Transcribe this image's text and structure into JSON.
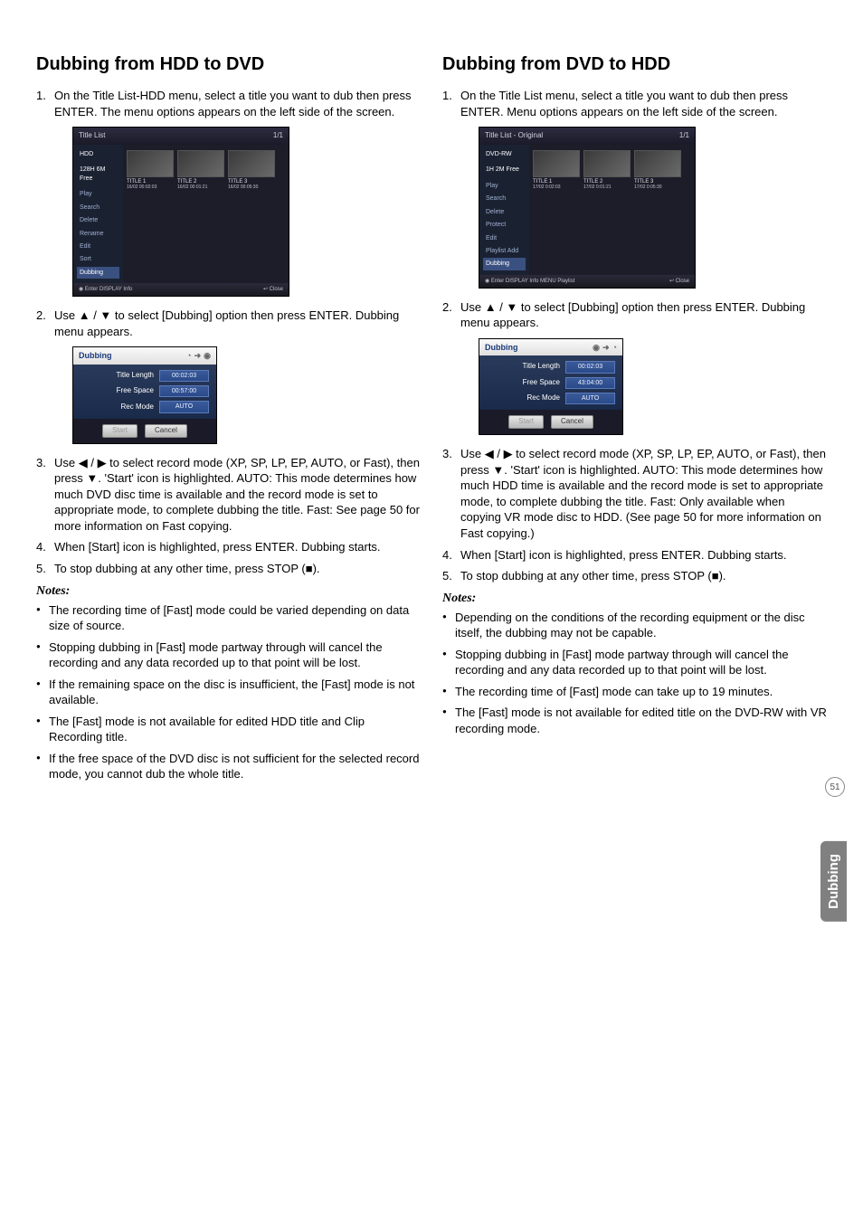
{
  "section_tab": "Dubbing",
  "page_number": "51",
  "left": {
    "heading": "Dubbing from HDD to DVD",
    "steps": [
      "On the Title List-HDD menu, select a title you want to dub then press ENTER.\nThe menu options appears on the left side of the screen.",
      "Use ▲ / ▼ to select [Dubbing] option then press ENTER.\nDubbing menu appears.",
      "Use ◀ / ▶ to select record mode (XP, SP, LP, EP, AUTO, or Fast), then press ▼.\n'Start' icon is highlighted.\nAUTO: This mode determines how much DVD disc time is available and the record mode is set to appropriate mode, to complete dubbing the title.\nFast: See page 50 for more information on Fast copying.",
      "When [Start] icon is highlighted, press ENTER. Dubbing starts.",
      "To stop dubbing at any other time, press STOP (■)."
    ],
    "notes_label": "Notes:",
    "notes": [
      "The recording time of [Fast] mode could be varied depending on data size of source.",
      "Stopping dubbing in [Fast] mode partway through will cancel the recording and any data recorded up to that point will be lost.",
      "If the remaining space on the disc is insufficient, the [Fast] mode is not available.",
      "The [Fast] mode is not available for edited HDD title and Clip Recording title.",
      "If the free space of the DVD disc is not sufficient for the selected record mode, you cannot dub the whole title."
    ],
    "title_list": {
      "title": "Title List",
      "page": "1/1",
      "source": "HDD",
      "capacity": "128H 6M Free",
      "menu": [
        "Play",
        "Search",
        "Delete",
        "Rename",
        "Edit",
        "Sort",
        "Dubbing"
      ],
      "thumbs": [
        {
          "t": "TITLE 1",
          "d": "16/02  00:02:03"
        },
        {
          "t": "TITLE 2",
          "d": "16/02  00:01:21"
        },
        {
          "t": "TITLE 3",
          "d": "16/02  00:05:30"
        }
      ],
      "footer_left": "◉ Enter  DISPLAY Info",
      "footer_right": "↩ Close"
    },
    "dub_panel": {
      "header": "Dubbing",
      "arrow_icons": "HDD ➜ DVD",
      "rows": [
        {
          "label": "Title Length",
          "value": "00:02:03"
        },
        {
          "label": "Free Space",
          "value": "00:57:00"
        },
        {
          "label": "Rec Mode",
          "value": "AUTO"
        }
      ],
      "start": "Start",
      "cancel": "Cancel"
    }
  },
  "right": {
    "heading": "Dubbing from DVD to HDD",
    "steps": [
      "On the Title List menu, select a title you want to dub then press ENTER.\nMenu options appears on the left side of the screen.",
      "Use ▲ / ▼ to select [Dubbing] option then press ENTER.\nDubbing menu appears.",
      "Use ◀ / ▶ to select record mode (XP, SP, LP, EP, AUTO, or Fast), then press ▼.\n'Start' icon is highlighted.\nAUTO: This mode determines how much HDD time is available and the record mode is set to appropriate mode, to complete dubbing the title.\nFast: Only available when copying VR mode disc to HDD. (See page 50 for more information on Fast copying.)",
      "When [Start] icon is highlighted, press ENTER. Dubbing starts.",
      "To stop dubbing at any other time, press STOP (■)."
    ],
    "notes_label": "Notes:",
    "notes": [
      "Depending on the conditions of the recording equipment or the disc itself, the dubbing may not be capable.",
      "Stopping dubbing in [Fast] mode partway through will cancel the recording and any data recorded up to that point will be lost.",
      "The recording time of [Fast] mode can take up to 19 minutes.",
      "The [Fast] mode is not available for edited title on the DVD-RW with VR recording mode."
    ],
    "title_list": {
      "title": "Title List - Original",
      "page": "1/1",
      "source": "DVD-RW",
      "capacity": "1H 2M Free",
      "menu": [
        "Play",
        "Search",
        "Delete",
        "Protect",
        "Edit",
        "Playlist Add",
        "Dubbing"
      ],
      "thumbs": [
        {
          "t": "TITLE 1",
          "d": "17/02  0:02:03"
        },
        {
          "t": "TITLE 2",
          "d": "17/02  0:01:21"
        },
        {
          "t": "TITLE 3",
          "d": "17/02  0:05:30"
        }
      ],
      "footer_left": "◉ Enter  DISPLAY Info  MENU Playlist",
      "footer_right": "↩ Close"
    },
    "dub_panel": {
      "header": "Dubbing",
      "arrow_icons": "DVD ➜ HDD",
      "rows": [
        {
          "label": "Title Length",
          "value": "00:02:03"
        },
        {
          "label": "Free Space",
          "value": "43:04:00"
        },
        {
          "label": "Rec Mode",
          "value": "AUTO"
        }
      ],
      "start": "Start",
      "cancel": "Cancel"
    }
  }
}
